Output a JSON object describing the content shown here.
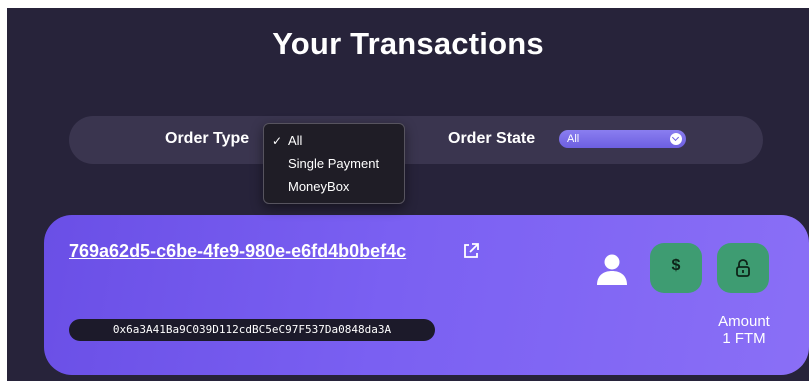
{
  "page": {
    "title": "Your Transactions"
  },
  "filters": {
    "order_type_label": "Order Type",
    "order_state_label": "Order State",
    "order_state_value": "All"
  },
  "order_type_dropdown": {
    "check_mark": "✓",
    "options": [
      "All",
      "Single Payment",
      "MoneyBox"
    ],
    "selected": "All"
  },
  "transaction": {
    "id": "769a62d5-c6be-4fe9-980e-e6fd4b0bef4c",
    "address": "0x6a3A41Ba9C039D112cdBC5eC97F537Da0848da3A",
    "amount_label": "Amount",
    "amount_value": "1 FTM",
    "pay_symbol": "$",
    "icons": {
      "external_link": "external-link-icon",
      "user": "user-icon",
      "pay": "dollar-icon",
      "lock": "lock-icon"
    }
  },
  "colors": {
    "background": "#27233a",
    "filter_bar": "#3a354f",
    "card_gradient_start": "#6a4fe6",
    "card_gradient_end": "#8a6ff6",
    "action_button": "#3e9c72",
    "select_accent": "#7b6ee8"
  }
}
